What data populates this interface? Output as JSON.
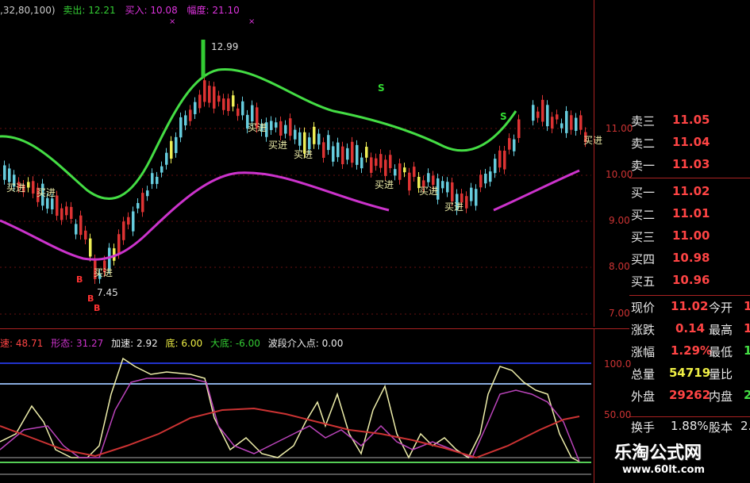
{
  "header": {
    "params": ",32,80,100)",
    "sell_label": "卖出:",
    "sell_value": "12.21",
    "buy_label": "买入:",
    "buy_value": "10.08",
    "amp_label": "幅度:",
    "amp_value": "21.10"
  },
  "price_chart": {
    "high_marker": "12.99",
    "low_marker": "7.45",
    "axis_ticks": [
      "11.00",
      "10.00",
      "9.00",
      "8.00",
      "7.00"
    ],
    "annotations": [
      "买进",
      "买进",
      "买进",
      "买进",
      "买进",
      "买进",
      "买进",
      "买进",
      "买进",
      "买进",
      "S",
      "S",
      "B",
      "B",
      "B"
    ],
    "colors": {
      "upper_band": "#44dd44",
      "lower_band": "#cc33cc",
      "up_candle": "#dd3333",
      "down_candle": "#66ccdd",
      "signal_candle": "#eeee55"
    }
  },
  "order_book": {
    "sells": [
      {
        "label": "卖三",
        "value": "11.05"
      },
      {
        "label": "卖二",
        "value": "11.04"
      },
      {
        "label": "卖一",
        "value": "11.03"
      }
    ],
    "buys": [
      {
        "label": "买一",
        "value": "11.02"
      },
      {
        "label": "买二",
        "value": "11.01"
      },
      {
        "label": "买三",
        "value": "11.00"
      },
      {
        "label": "买四",
        "value": "10.98"
      },
      {
        "label": "买五",
        "value": "10.96"
      }
    ]
  },
  "quote": {
    "rows": [
      {
        "l1": "现价",
        "v1": "11.02",
        "l2": "今开",
        "v2": "1"
      },
      {
        "l1": "涨跌",
        "v1": "0.14",
        "l2": "最高",
        "v2": "1"
      },
      {
        "l1": "涨幅",
        "v1": "1.29%",
        "l2": "最低",
        "v2": "1"
      },
      {
        "l1": "总量",
        "v1": "54719",
        "l2": "量比",
        "v2": ""
      },
      {
        "l1": "外盘",
        "v1": "29262",
        "l2": "内盘",
        "v2": "2"
      },
      {
        "l1": "换手",
        "v1": "1.88%",
        "l2": "股本",
        "v2": "2."
      }
    ]
  },
  "indicator": {
    "speed_label": "速:",
    "speed_value": "48.71",
    "shape_label": "形态:",
    "shape_value": "31.27",
    "accel_label": "加速:",
    "accel_value": "2.92",
    "bottom_label": "底:",
    "bottom_value": "6.00",
    "big_bottom_label": "大底:",
    "big_bottom_value": "-6.00",
    "entry_label": "波段介入点:",
    "entry_value": "0.00",
    "axis_ticks": [
      "100.0",
      "50.00"
    ]
  },
  "watermark": {
    "title": "乐淘公式网",
    "url": "www.60lt.com"
  }
}
